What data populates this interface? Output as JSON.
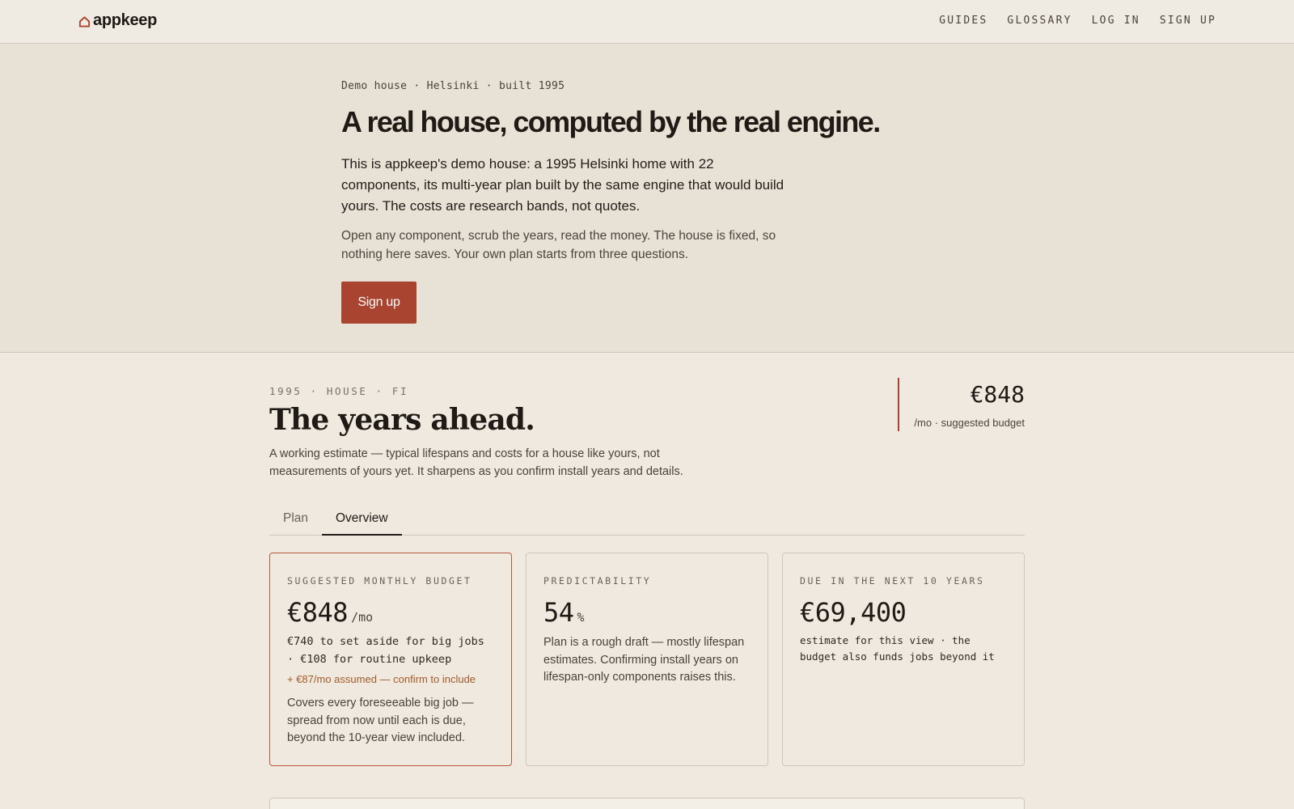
{
  "nav": {
    "logo": "appkeep",
    "links": [
      "GUIDES",
      "GLOSSARY",
      "LOG IN",
      "SIGN UP"
    ]
  },
  "hero": {
    "eyebrow": "Demo house · Helsinki · built 1995",
    "title": "A real house, computed by the real engine.",
    "lead": "This is appkeep's demo house: a 1995 Helsinki home with 22 components, its multi-year plan built by the same engine that would build yours. The costs are research bands, not quotes.",
    "sub": "Open any component, scrub the years, read the money. The house is fixed, so nothing here saves. Your own plan starts from three questions.",
    "cta": "Sign up"
  },
  "section": {
    "eyebrow": "1995 · HOUSE · FI",
    "title": "The years ahead.",
    "description": "A working estimate — typical lifespans and costs for a house like yours, not measurements of yours yet. It sharpens as you confirm install years and details.",
    "budget_amount": "€848",
    "budget_label": "/mo · suggested budget"
  },
  "tabs": [
    "Plan",
    "Overview"
  ],
  "active_tab": "Overview",
  "cards": [
    {
      "label": "SUGGESTED MONTHLY BUDGET",
      "value": "€848",
      "unit": "/mo",
      "detail": "€740 to set aside for big jobs · €108 for routine upkeep",
      "note": "+ €87/mo assumed — confirm to include",
      "body": "Covers every foreseeable big job — spread from now until each is due, beyond the 10-year view included."
    },
    {
      "label": "PREDICTABILITY",
      "value": "54",
      "unit": "%",
      "body": "Plan is a rough draft — mostly lifespan estimates. Confirming install years on lifespan-only components raises this."
    },
    {
      "label": "DUE IN THE NEXT 10 YEARS",
      "value": "€69,400",
      "detail": "estimate for this view · the budget also funds jobs beyond it"
    }
  ],
  "colors": {
    "accent": "#a8442f",
    "background": "#efe9df",
    "hero_background": "#e8e1d5",
    "note": "#a35a29"
  }
}
